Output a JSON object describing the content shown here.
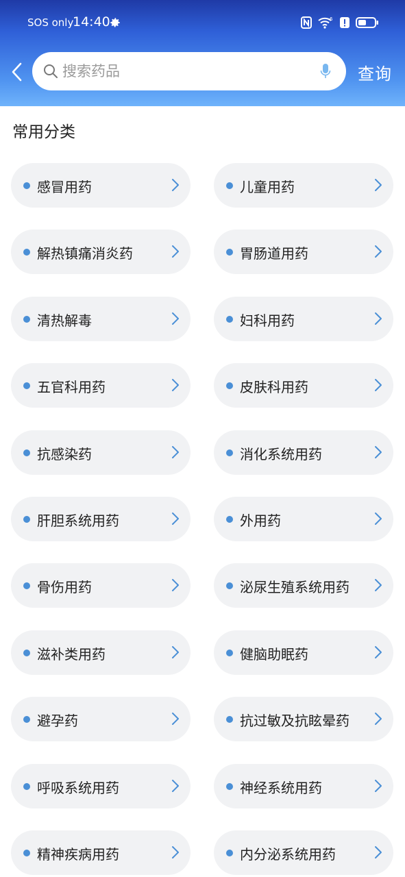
{
  "status_bar": {
    "carrier": "SOS only",
    "time": "14:40"
  },
  "search": {
    "placeholder": "搜索药品",
    "query_label": "查询"
  },
  "section_title": "常用分类",
  "categories": [
    "感冒用药",
    "儿童用药",
    "解热镇痛消炎药",
    "胃肠道用药",
    "清热解毒",
    "妇科用药",
    "五官科用药",
    "皮肤科用药",
    "抗感染药",
    "消化系统用药",
    "肝胆系统用药",
    "外用药",
    "骨伤用药",
    "泌尿生殖系统用药",
    "滋补类用药",
    "健脑助眠药",
    "避孕药",
    "抗过敏及抗眩晕药",
    "呼吸系统用药",
    "神经系统用药",
    "精神疾病用药",
    "内分泌系统用药"
  ],
  "colors": {
    "accent": "#4a8fd6",
    "header_top": "#1f3aa6",
    "header_bottom": "#6fb3fb",
    "item_bg": "#f1f2f4"
  }
}
